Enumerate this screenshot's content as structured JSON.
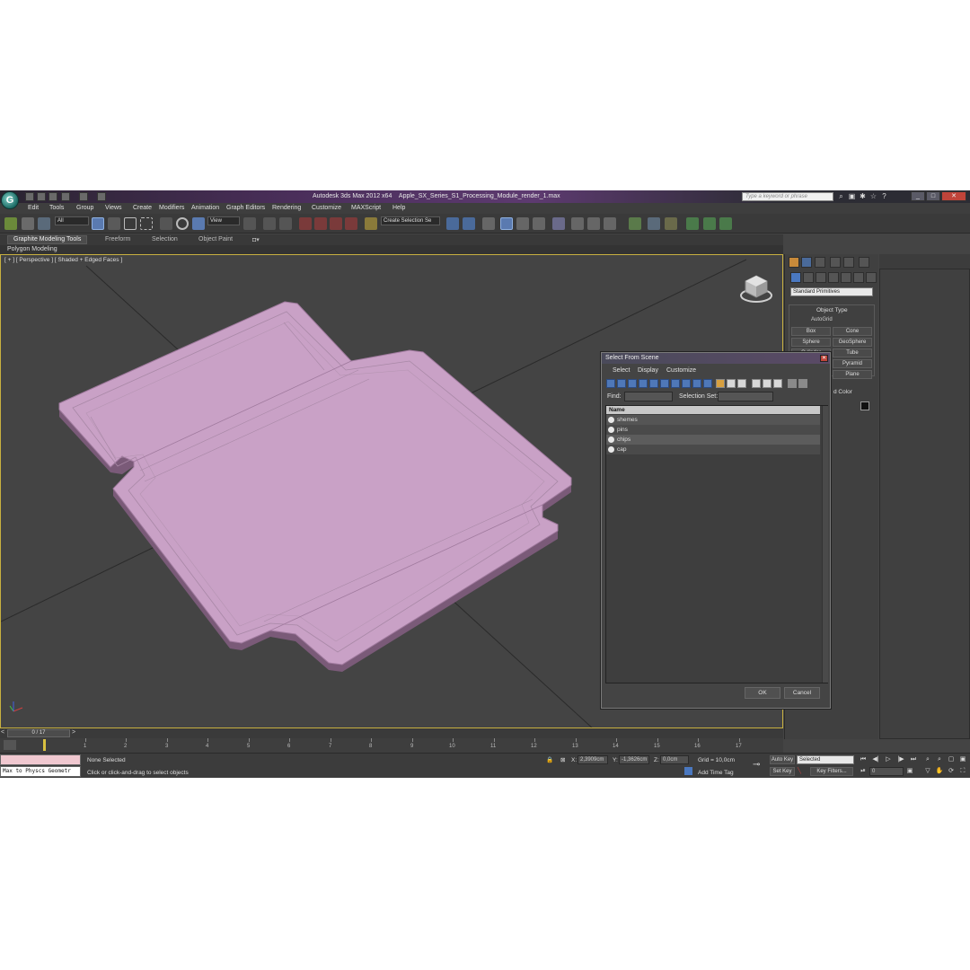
{
  "titlebar": {
    "app_name": "Autodesk 3ds Max  2012 x64",
    "file_name": "Apple_SX_Series_S1_Processing_Module_render_1.max",
    "search_placeholder": "Type a keyword or phrase",
    "logo_letter": "G"
  },
  "menubar": {
    "items": [
      "Edit",
      "Tools",
      "Group",
      "Views",
      "Create",
      "Modifiers",
      "Animation",
      "Graph Editors",
      "Rendering",
      "Customize",
      "MAXScript",
      "Help"
    ]
  },
  "toolbar": {
    "filter_value": "All",
    "refcoord_value": "View",
    "selection_set_value": "Create Selection Se"
  },
  "ribbon": {
    "tabs": [
      "Graphite Modeling Tools",
      "Freeform",
      "Selection",
      "Object Paint"
    ],
    "sub_label": "Polygon Modeling"
  },
  "viewport": {
    "label": "[ + ] [ Perspective ] [ Shaded + Edged Faces ]",
    "object_color": "#c9a1c6"
  },
  "command_panel": {
    "category": "Standard Primitives",
    "rollout_title": "Object Type",
    "autogrid": "AutoGrid",
    "primitives": [
      "Box",
      "Cone",
      "Sphere",
      "GeoSphere",
      "Cylinder",
      "Tube",
      "",
      "Pyramid",
      "",
      "Plane"
    ],
    "name_color_title": "d Color"
  },
  "dialog": {
    "title": "Select From Scene",
    "menu": [
      "Select",
      "Display",
      "Customize"
    ],
    "find_label": "Find:",
    "selection_set_label": "Selection Set:",
    "column_name": "Name",
    "rows": [
      "shemes",
      "pins",
      "chips",
      "cap"
    ],
    "ok": "OK",
    "cancel": "Cancel"
  },
  "timeline": {
    "frame_display": "0 / 17",
    "ticks": [
      "1",
      "2",
      "3",
      "4",
      "5",
      "6",
      "7",
      "8",
      "9",
      "10",
      "11",
      "12",
      "13",
      "14",
      "15",
      "16",
      "17"
    ]
  },
  "statusbar": {
    "listener_text": "Max to Physcs Geometr",
    "selection_status": "None Selected",
    "prompt": "Click or click-and-drag to select objects",
    "x_label": "X:",
    "x_value": "2,3909cm",
    "y_label": "Y:",
    "y_value": "-1,3626cm",
    "z_label": "Z:",
    "z_value": "0,0cm",
    "grid": "Grid = 10,0cm",
    "add_time_tag": "Add Time Tag",
    "auto_key": "Auto Key",
    "set_key": "Set Key",
    "selected_value": "Selected",
    "key_filters": "Key Filters...",
    "frame_value": "0"
  }
}
